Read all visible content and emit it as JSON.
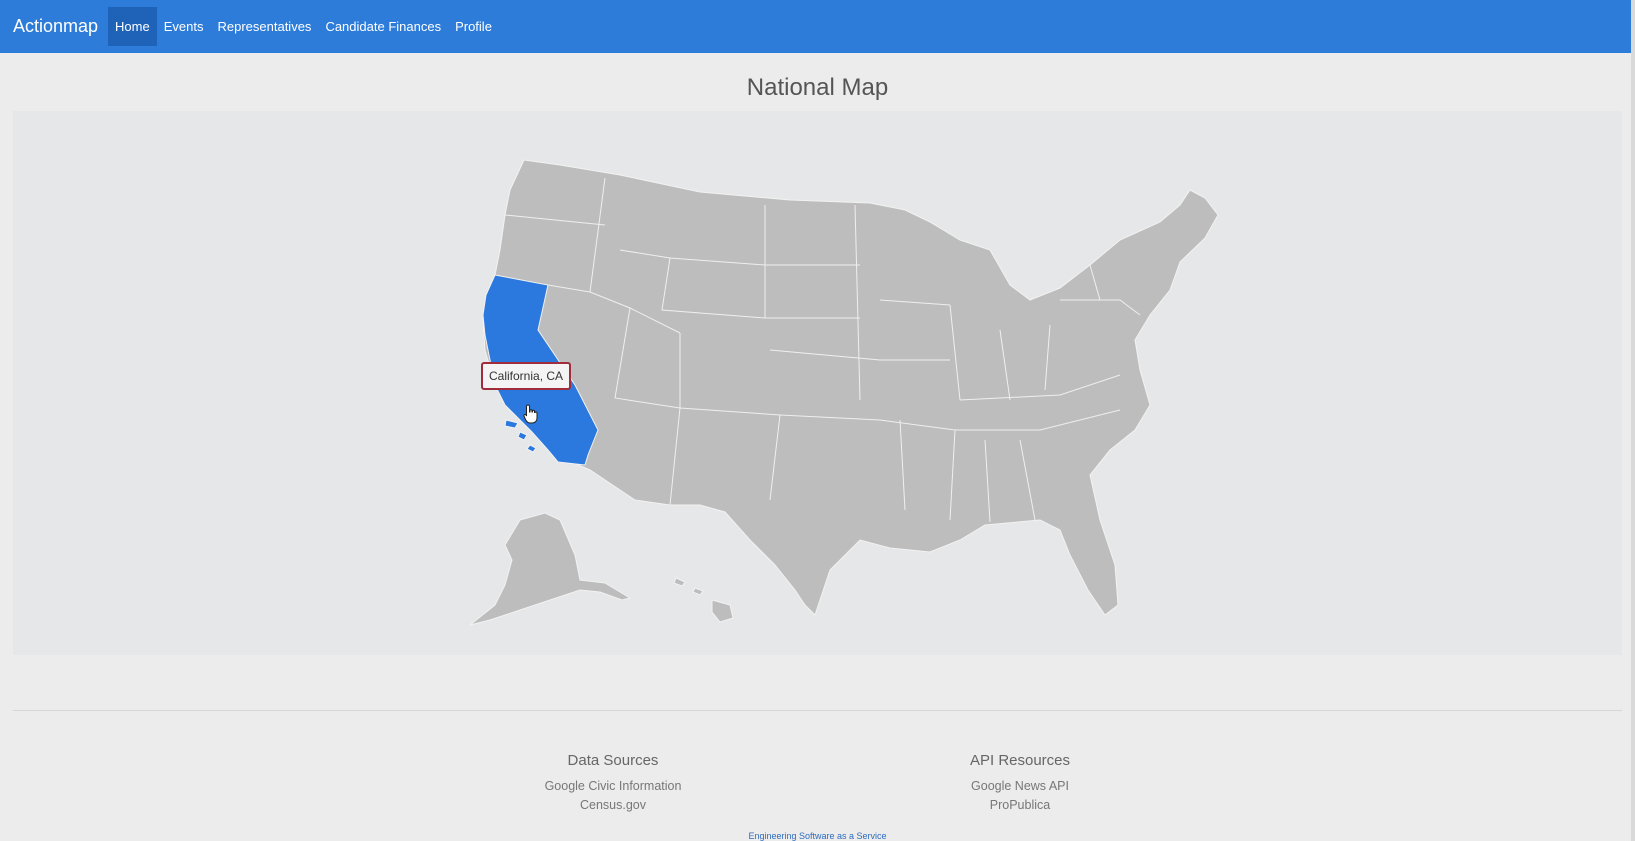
{
  "navbar": {
    "brand": "Actionmap",
    "items": [
      {
        "label": "Home",
        "active": true
      },
      {
        "label": "Events",
        "active": false
      },
      {
        "label": "Representatives",
        "active": false
      },
      {
        "label": "Candidate Finances",
        "active": false
      },
      {
        "label": "Profile",
        "active": false
      }
    ]
  },
  "main": {
    "title": "National Map",
    "map": {
      "tooltip": "California, CA",
      "selected_state": "CA",
      "colors": {
        "state_fill": "#bdbdbd",
        "selected_fill": "#2b78de",
        "background": "#e6e7e8"
      }
    }
  },
  "footer": {
    "data_sources": {
      "heading": "Data Sources",
      "links": [
        "Google Civic Information",
        "Census.gov"
      ]
    },
    "api_resources": {
      "heading": "API Resources",
      "links": [
        "Google News API",
        "ProPublica"
      ]
    },
    "note": "Engineering Software as a Service"
  },
  "colors": {
    "navbar": "#2d7cd9",
    "navbar_active": "#1f63b8",
    "page_background": "#ececec"
  }
}
